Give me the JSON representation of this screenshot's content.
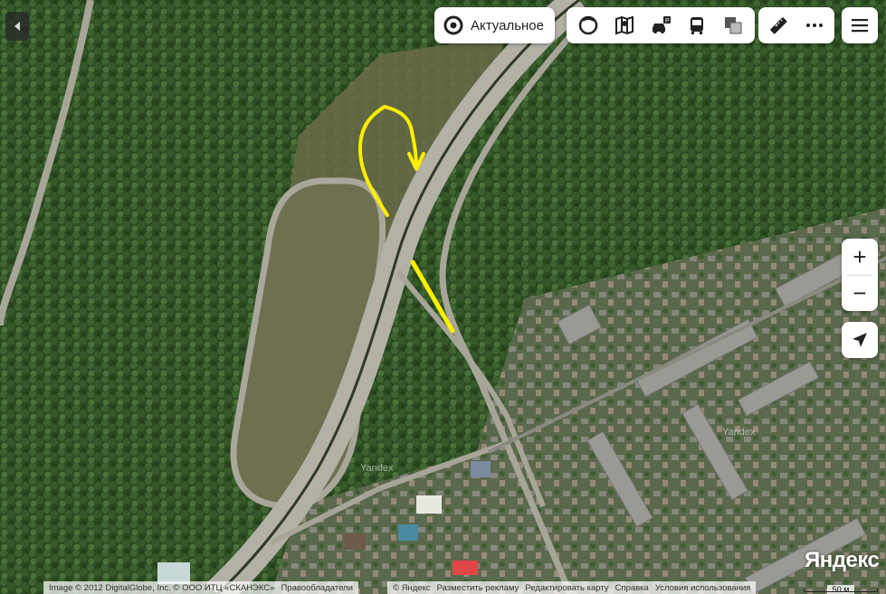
{
  "map": {
    "type": "satellite",
    "watermarks": [
      "Yandex",
      "Yandex",
      "Yandex"
    ]
  },
  "traffic": {
    "label": "Актуальное",
    "icon": "traffic-target-icon"
  },
  "layers": {
    "icons": [
      "panorama-icon",
      "map-layers-icon",
      "parking-icon",
      "transport-icon",
      "layer-switch-icon"
    ]
  },
  "tools": {
    "icons": [
      "ruler-icon",
      "more-icon"
    ]
  },
  "menu": {
    "icon": "hamburger-menu-icon"
  },
  "zoom": {
    "in_label": "+",
    "out_label": "−"
  },
  "geolocation": {
    "icon": "location-arrow-icon"
  },
  "footer": {
    "copyright": "Image © 2012 DigitalGlobe, Inc. © ООО ИТЦ «СКАНЭКС»",
    "rights_link": "Правообладатели",
    "yandex_copyright": "© Яндекс",
    "links": [
      "Разместить рекламу",
      "Редактировать карту",
      "Справка",
      "Условия использования"
    ]
  },
  "brand": "Яндекс",
  "scale": {
    "label": "50 м"
  },
  "colors": {
    "annotation": "#ffee00",
    "panel": "#ffffff"
  }
}
